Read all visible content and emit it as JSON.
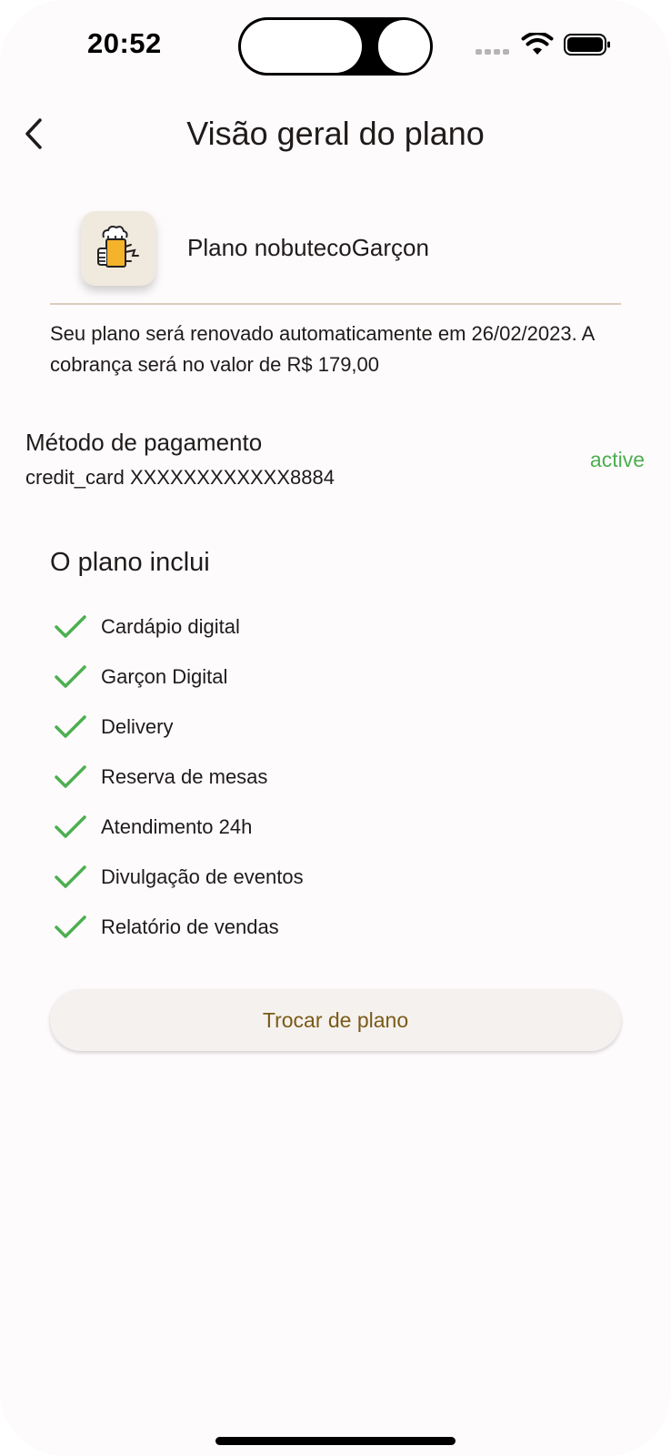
{
  "status_bar": {
    "time": "20:52"
  },
  "header": {
    "title": "Visão geral do plano",
    "back_icon": "chevron-left-icon"
  },
  "plan": {
    "logo_icon": "beer-waiter-icon",
    "name": "Plano nobutecoGarçon",
    "renewal_text": "Seu plano será renovado automaticamente em 26/02/2023. A cobrança será no valor de R$ 179,00"
  },
  "payment": {
    "label": "Método de pagamento",
    "card": "credit_card XXXXXXXXXXXX8884",
    "status": "active",
    "status_color": "#4caf50"
  },
  "features": {
    "title": "O plano inclui",
    "check_icon": "check-icon",
    "check_color": "#4caf50",
    "items": [
      "Cardápio digital",
      "Garçon Digital",
      "Delivery",
      "Reserva de mesas",
      "Atendimento 24h",
      "Divulgação de eventos",
      "Relatório de vendas"
    ]
  },
  "actions": {
    "change_plan_label": "Trocar de plano",
    "change_plan_color": "#7a5a16"
  }
}
